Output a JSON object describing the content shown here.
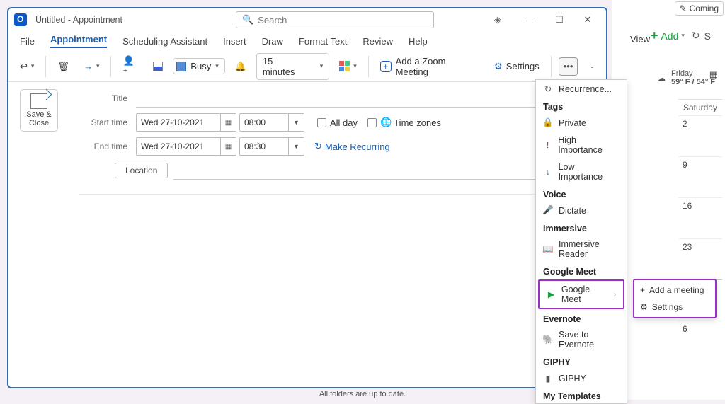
{
  "window": {
    "title": "Untitled  -  Appointment",
    "search_placeholder": "Search"
  },
  "tabs": {
    "file": "File",
    "appointment": "Appointment",
    "scheduling": "Scheduling Assistant",
    "insert": "Insert",
    "draw": "Draw",
    "format": "Format Text",
    "review": "Review",
    "help": "Help"
  },
  "ribbon": {
    "busy": "Busy",
    "reminder": "15 minutes",
    "zoom": "Add a Zoom Meeting",
    "settings": "Settings"
  },
  "form": {
    "save_close": "Save & Close",
    "title_label": "Title",
    "start_label": "Start time",
    "end_label": "End time",
    "location_label": "Location",
    "start_date": "Wed 27-10-2021",
    "start_time": "08:00",
    "end_date": "Wed 27-10-2021",
    "end_time": "08:30",
    "all_day": "All day",
    "time_zones": "Time zones",
    "make_recurring": "Make Recurring"
  },
  "overflow": {
    "recurrence": "Recurrence...",
    "tags_head": "Tags",
    "private": "Private",
    "high": "High Importance",
    "low": "Low Importance",
    "voice_head": "Voice",
    "dictate": "Dictate",
    "immersive_head": "Immersive",
    "immersive": "Immersive Reader",
    "gm_head": "Google Meet",
    "gm": "Google Meet",
    "ev_head": "Evernote",
    "ev": "Save to Evernote",
    "giphy_head": "GIPHY",
    "giphy": "GIPHY",
    "tmpl_head": "My Templates"
  },
  "flyout": {
    "add_meeting": "Add a meeting",
    "settings": "Settings"
  },
  "bg": {
    "coming": "Coming",
    "view": "View",
    "add": "Add",
    "friday": "Friday",
    "temp": "59° F / 54° F",
    "sat_head": "Saturday",
    "d1": "2",
    "d2": "9",
    "d3": "16",
    "d4": "23",
    "d5": "6"
  },
  "status": "All folders are up to date."
}
